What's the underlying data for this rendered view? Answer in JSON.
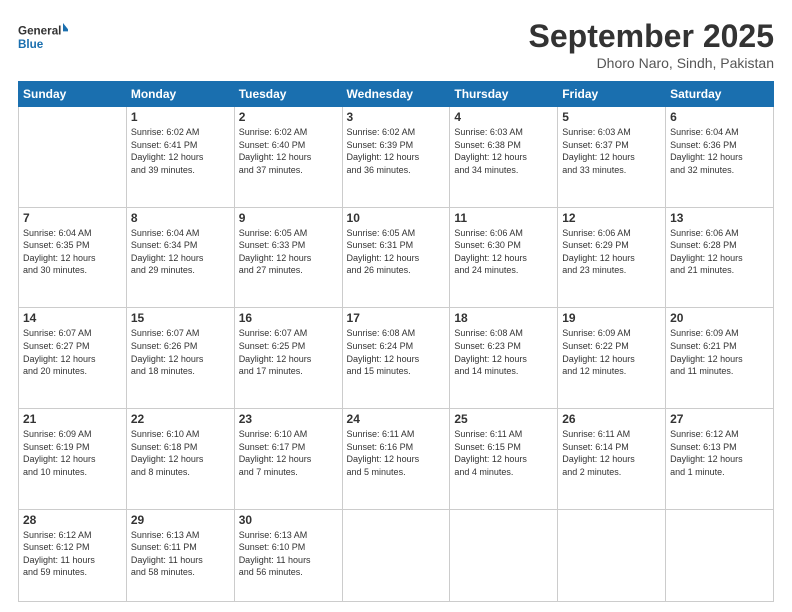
{
  "header": {
    "logo_line1": "General",
    "logo_line2": "Blue",
    "title": "September 2025",
    "location": "Dhoro Naro, Sindh, Pakistan"
  },
  "weekdays": [
    "Sunday",
    "Monday",
    "Tuesday",
    "Wednesday",
    "Thursday",
    "Friday",
    "Saturday"
  ],
  "weeks": [
    [
      {
        "day": "",
        "info": ""
      },
      {
        "day": "1",
        "info": "Sunrise: 6:02 AM\nSunset: 6:41 PM\nDaylight: 12 hours\nand 39 minutes."
      },
      {
        "day": "2",
        "info": "Sunrise: 6:02 AM\nSunset: 6:40 PM\nDaylight: 12 hours\nand 37 minutes."
      },
      {
        "day": "3",
        "info": "Sunrise: 6:02 AM\nSunset: 6:39 PM\nDaylight: 12 hours\nand 36 minutes."
      },
      {
        "day": "4",
        "info": "Sunrise: 6:03 AM\nSunset: 6:38 PM\nDaylight: 12 hours\nand 34 minutes."
      },
      {
        "day": "5",
        "info": "Sunrise: 6:03 AM\nSunset: 6:37 PM\nDaylight: 12 hours\nand 33 minutes."
      },
      {
        "day": "6",
        "info": "Sunrise: 6:04 AM\nSunset: 6:36 PM\nDaylight: 12 hours\nand 32 minutes."
      }
    ],
    [
      {
        "day": "7",
        "info": "Sunrise: 6:04 AM\nSunset: 6:35 PM\nDaylight: 12 hours\nand 30 minutes."
      },
      {
        "day": "8",
        "info": "Sunrise: 6:04 AM\nSunset: 6:34 PM\nDaylight: 12 hours\nand 29 minutes."
      },
      {
        "day": "9",
        "info": "Sunrise: 6:05 AM\nSunset: 6:33 PM\nDaylight: 12 hours\nand 27 minutes."
      },
      {
        "day": "10",
        "info": "Sunrise: 6:05 AM\nSunset: 6:31 PM\nDaylight: 12 hours\nand 26 minutes."
      },
      {
        "day": "11",
        "info": "Sunrise: 6:06 AM\nSunset: 6:30 PM\nDaylight: 12 hours\nand 24 minutes."
      },
      {
        "day": "12",
        "info": "Sunrise: 6:06 AM\nSunset: 6:29 PM\nDaylight: 12 hours\nand 23 minutes."
      },
      {
        "day": "13",
        "info": "Sunrise: 6:06 AM\nSunset: 6:28 PM\nDaylight: 12 hours\nand 21 minutes."
      }
    ],
    [
      {
        "day": "14",
        "info": "Sunrise: 6:07 AM\nSunset: 6:27 PM\nDaylight: 12 hours\nand 20 minutes."
      },
      {
        "day": "15",
        "info": "Sunrise: 6:07 AM\nSunset: 6:26 PM\nDaylight: 12 hours\nand 18 minutes."
      },
      {
        "day": "16",
        "info": "Sunrise: 6:07 AM\nSunset: 6:25 PM\nDaylight: 12 hours\nand 17 minutes."
      },
      {
        "day": "17",
        "info": "Sunrise: 6:08 AM\nSunset: 6:24 PM\nDaylight: 12 hours\nand 15 minutes."
      },
      {
        "day": "18",
        "info": "Sunrise: 6:08 AM\nSunset: 6:23 PM\nDaylight: 12 hours\nand 14 minutes."
      },
      {
        "day": "19",
        "info": "Sunrise: 6:09 AM\nSunset: 6:22 PM\nDaylight: 12 hours\nand 12 minutes."
      },
      {
        "day": "20",
        "info": "Sunrise: 6:09 AM\nSunset: 6:21 PM\nDaylight: 12 hours\nand 11 minutes."
      }
    ],
    [
      {
        "day": "21",
        "info": "Sunrise: 6:09 AM\nSunset: 6:19 PM\nDaylight: 12 hours\nand 10 minutes."
      },
      {
        "day": "22",
        "info": "Sunrise: 6:10 AM\nSunset: 6:18 PM\nDaylight: 12 hours\nand 8 minutes."
      },
      {
        "day": "23",
        "info": "Sunrise: 6:10 AM\nSunset: 6:17 PM\nDaylight: 12 hours\nand 7 minutes."
      },
      {
        "day": "24",
        "info": "Sunrise: 6:11 AM\nSunset: 6:16 PM\nDaylight: 12 hours\nand 5 minutes."
      },
      {
        "day": "25",
        "info": "Sunrise: 6:11 AM\nSunset: 6:15 PM\nDaylight: 12 hours\nand 4 minutes."
      },
      {
        "day": "26",
        "info": "Sunrise: 6:11 AM\nSunset: 6:14 PM\nDaylight: 12 hours\nand 2 minutes."
      },
      {
        "day": "27",
        "info": "Sunrise: 6:12 AM\nSunset: 6:13 PM\nDaylight: 12 hours\nand 1 minute."
      }
    ],
    [
      {
        "day": "28",
        "info": "Sunrise: 6:12 AM\nSunset: 6:12 PM\nDaylight: 11 hours\nand 59 minutes."
      },
      {
        "day": "29",
        "info": "Sunrise: 6:13 AM\nSunset: 6:11 PM\nDaylight: 11 hours\nand 58 minutes."
      },
      {
        "day": "30",
        "info": "Sunrise: 6:13 AM\nSunset: 6:10 PM\nDaylight: 11 hours\nand 56 minutes."
      },
      {
        "day": "",
        "info": ""
      },
      {
        "day": "",
        "info": ""
      },
      {
        "day": "",
        "info": ""
      },
      {
        "day": "",
        "info": ""
      }
    ]
  ]
}
